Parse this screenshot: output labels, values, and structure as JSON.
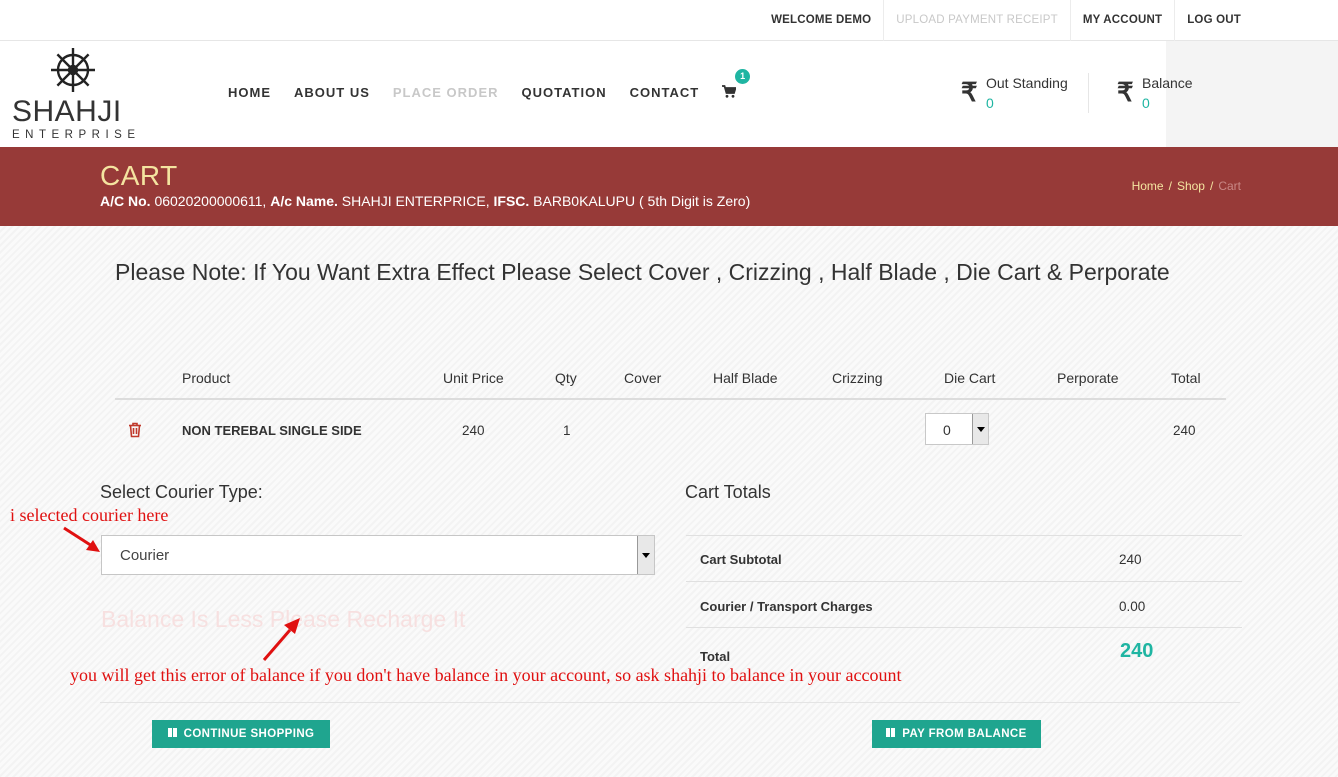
{
  "topbar": {
    "welcome": "WELCOME DEMO",
    "upload_receipt": "UPLOAD PAYMENT RECEIPT",
    "my_account": "MY ACCOUNT",
    "logout": "LOG OUT"
  },
  "logo": {
    "name": "SHAHJI",
    "sub": "ENTERPRISE"
  },
  "nav": {
    "home": "HOME",
    "about": "ABOUT US",
    "place_order": "PLACE ORDER",
    "quotation": "QUOTATION",
    "contact": "CONTACT",
    "cart_count": "1"
  },
  "stats": {
    "rupee": "₹",
    "outstanding_label": "Out Standing",
    "outstanding_value": "0",
    "balance_label": "Balance",
    "balance_value": "0"
  },
  "banner": {
    "title": "CART",
    "acno_label": "A/C No.",
    "acno": "06020200000611,",
    "acname_label": "A/c Name.",
    "acname": "SHAHJI ENTERPRICE,",
    "ifsc_label": "IFSC.",
    "ifsc": "BARB0KALUPU ( 5th Digit is Zero)",
    "breadcrumb": [
      "Home",
      "Shop",
      "Cart"
    ],
    "sep": "/"
  },
  "note": "Please Note: If You Want Extra Effect Please Select Cover , Crizzing , Half Blade , Die Cart & Perporate",
  "table": {
    "headers": [
      "Product",
      "Unit Price",
      "Qty",
      "Cover",
      "Half Blade",
      "Crizzing",
      "Die Cart",
      "Perporate",
      "Total"
    ],
    "rows": [
      {
        "product": "NON TEREBAL SINGLE SIDE",
        "unit_price": "240",
        "qty": "1",
        "die_cart": "0",
        "total": "240"
      }
    ]
  },
  "courier": {
    "title": "Select Courier Type:",
    "selected": "Courier",
    "error": "Balance Is Less Please Recharge It"
  },
  "totals": {
    "title": "Cart Totals",
    "subtotal_label": "Cart Subtotal",
    "subtotal": "240",
    "charges_label": "Courier / Transport Charges",
    "charges": "0.00",
    "total_label": "Total",
    "total": "240"
  },
  "buttons": {
    "continue": "CONTINUE SHOPPING",
    "pay": "PAY FROM BALANCE"
  },
  "annotations": {
    "courier_note": "i selected courier here",
    "error_note": "you will get this error  of balance if you don't have balance in your account, so ask shahji to balance in your account"
  },
  "colors": {
    "banner": "#973a38",
    "accent": "#1fb5a2",
    "button": "#1fa58f",
    "banner_title": "#f4e4a0",
    "annotation": "#e01010"
  }
}
